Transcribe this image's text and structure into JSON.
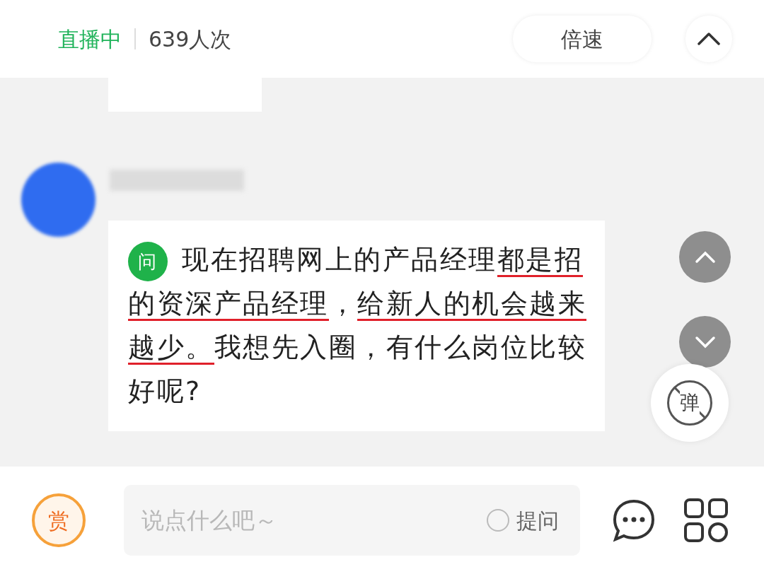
{
  "header": {
    "status": "直播中",
    "viewers": "639人次",
    "speed_button": "倍速"
  },
  "message": {
    "badge": "问",
    "segments": [
      {
        "text": "现在招聘网上的产品经理",
        "underlined": false
      },
      {
        "text": "都是招",
        "underlined": true
      },
      {
        "text": "的资深产品经理",
        "underlined": true
      },
      {
        "text": "，",
        "underlined": false
      },
      {
        "text": "给新人的机会越来",
        "underlined": true
      },
      {
        "text": "越少。",
        "underlined": true
      },
      {
        "text": "我想先入圈，有什么岗位比较好呢?",
        "underlined": false
      }
    ]
  },
  "danmaku": {
    "label": "弹",
    "on": false
  },
  "bottom_bar": {
    "reward": "赏",
    "input": {
      "placeholder": "说点什么吧～"
    },
    "ask": {
      "label": "提问",
      "checked": false
    }
  }
}
